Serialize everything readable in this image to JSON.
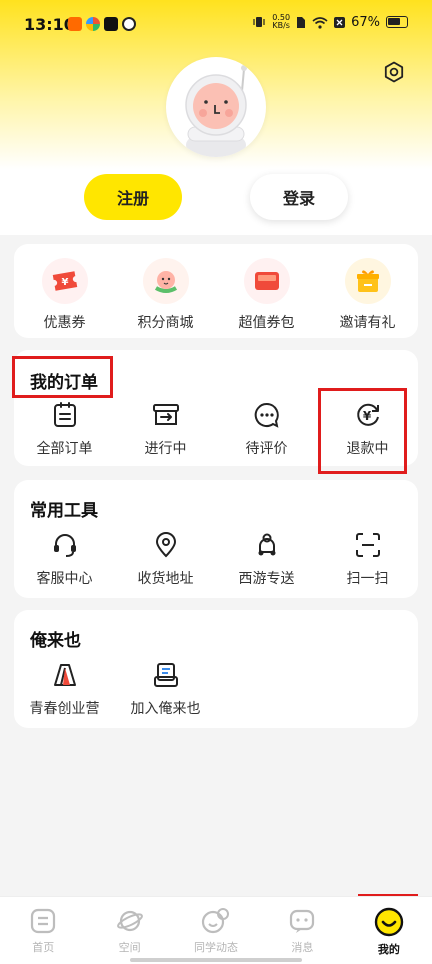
{
  "status": {
    "time": "13:10",
    "net_speed_top": "0.50",
    "net_speed_bottom": "KB/s",
    "battery": "67%"
  },
  "auth": {
    "register": "注册",
    "login": "登录"
  },
  "benefits": [
    {
      "label": "优惠券",
      "icon": "coupon-icon"
    },
    {
      "label": "积分商城",
      "icon": "peach-icon"
    },
    {
      "label": "超值券包",
      "icon": "wallet-icon"
    },
    {
      "label": "邀请有礼",
      "icon": "gift-icon"
    }
  ],
  "orders": {
    "title": "我的订单",
    "items": [
      {
        "label": "全部订单",
        "icon": "clipboard-icon"
      },
      {
        "label": "进行中",
        "icon": "box-arrow-icon"
      },
      {
        "label": "待评价",
        "icon": "chat-bubble-icon"
      },
      {
        "label": "退款中",
        "icon": "yen-refresh-icon"
      }
    ]
  },
  "tools": {
    "title": "常用工具",
    "items": [
      {
        "label": "客服中心",
        "icon": "headset-icon"
      },
      {
        "label": "收货地址",
        "icon": "location-pin-icon"
      },
      {
        "label": "西游专送",
        "icon": "scooter-icon"
      },
      {
        "label": "扫一扫",
        "icon": "scan-icon"
      }
    ]
  },
  "anlaiye": {
    "title": "俺来也",
    "items": [
      {
        "label": "青春创业营",
        "icon": "tent-icon"
      },
      {
        "label": "加入俺来也",
        "icon": "join-doc-icon"
      }
    ]
  },
  "tabs": [
    {
      "label": "首页",
      "icon": "home-icon"
    },
    {
      "label": "空间",
      "icon": "planet-icon"
    },
    {
      "label": "同学动态",
      "icon": "classmates-icon"
    },
    {
      "label": "消息",
      "icon": "message-icon"
    },
    {
      "label": "我的",
      "icon": "smiley-icon",
      "active": true
    }
  ],
  "colors": {
    "brand_yellow": "#ffe600",
    "highlight_red": "#e01c1c",
    "accent_red": "#f04a3a"
  }
}
